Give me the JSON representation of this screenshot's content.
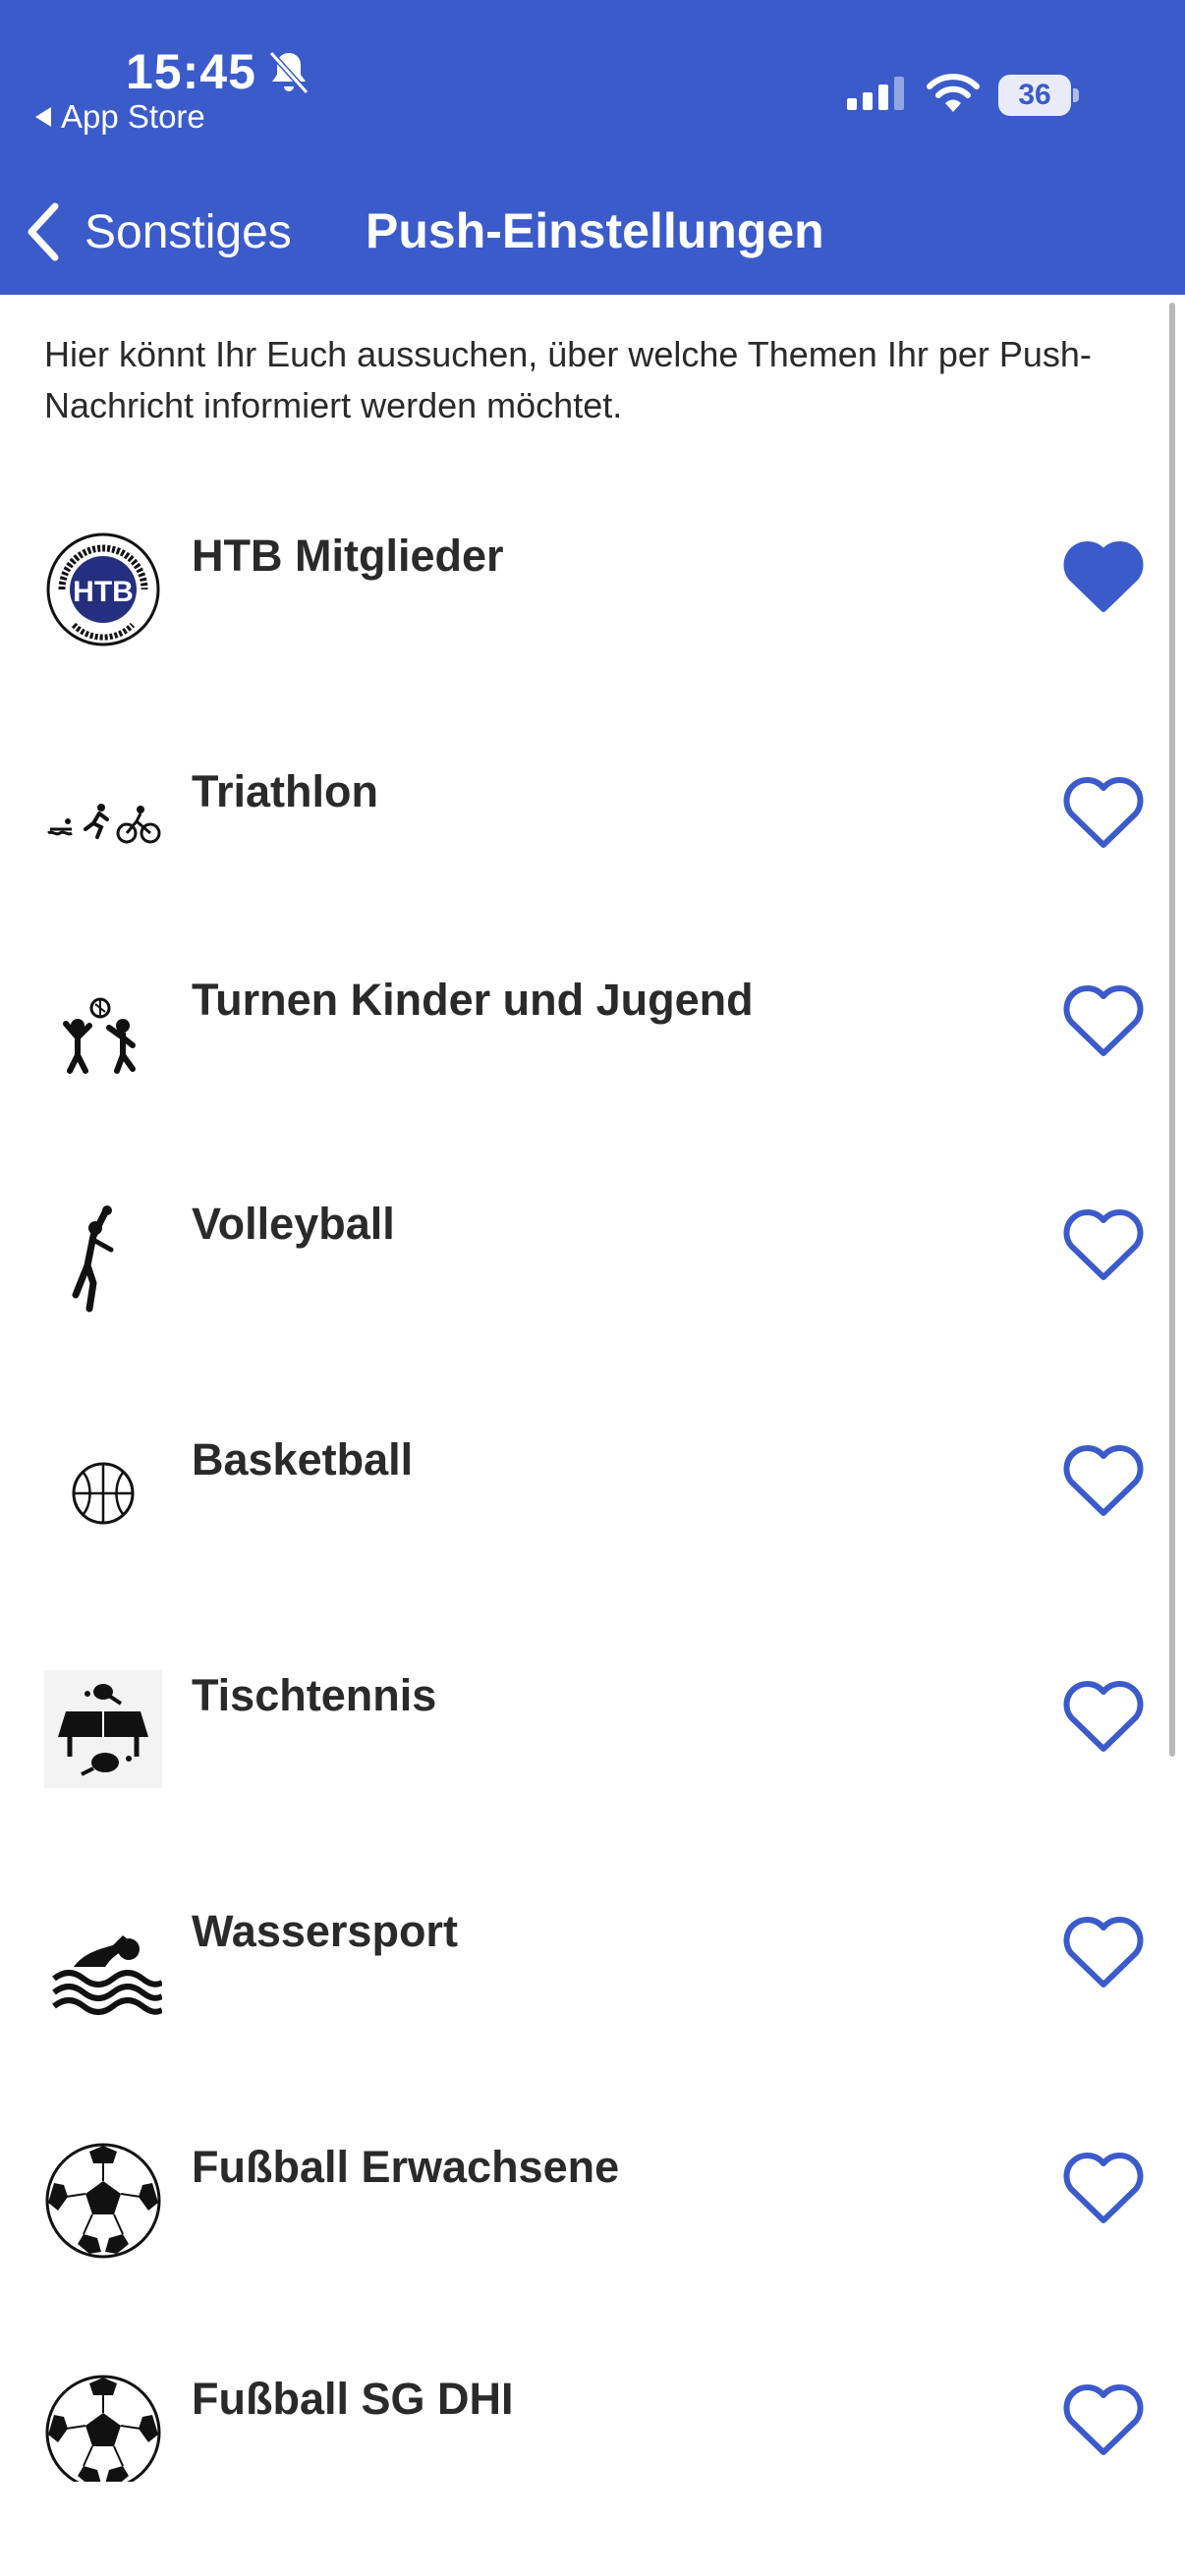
{
  "status_bar": {
    "time": "15:45",
    "back_app": "App Store",
    "battery": "36"
  },
  "nav": {
    "back_label": "Sonstiges",
    "title": "Push-Einstellungen"
  },
  "intro": "Hier könnt Ihr Euch aussuchen, über welche Themen Ihr per Push-Nachricht informiert werden möchtet.",
  "topics": [
    {
      "label": "HTB Mitglieder",
      "icon": "htb-logo",
      "favorited": true
    },
    {
      "label": "Triathlon",
      "icon": "triathlon-icon",
      "favorited": false
    },
    {
      "label": "Turnen Kinder und Jugend",
      "icon": "kids-gymnastics-icon",
      "favorited": false
    },
    {
      "label": "Volleyball",
      "icon": "volleyball-player-icon",
      "favorited": false
    },
    {
      "label": "Basketball",
      "icon": "basketball-icon",
      "favorited": false
    },
    {
      "label": "Tischtennis",
      "icon": "table-tennis-icon",
      "favorited": false
    },
    {
      "label": "Wassersport",
      "icon": "swimmer-icon",
      "favorited": false
    },
    {
      "label": "Fußball Erwachsene",
      "icon": "soccer-ball-icon",
      "favorited": false
    },
    {
      "label": "Fußball SG DHI",
      "icon": "soccer-ball-icon",
      "favorited": false
    }
  ],
  "colors": {
    "header": "#3b5bcb",
    "accent": "#3b5bcb"
  }
}
